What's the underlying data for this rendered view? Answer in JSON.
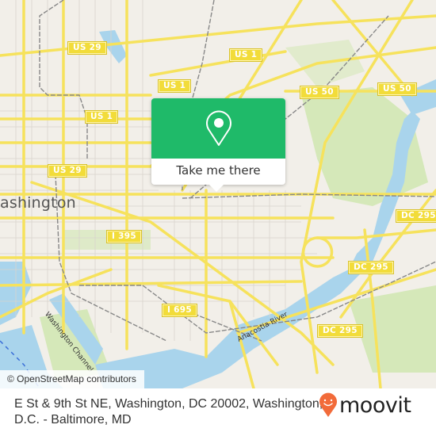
{
  "map": {
    "city_label": "ashington",
    "river_labels": {
      "anacostia": "Anacostia River",
      "washington_channel": "Washington Channel"
    },
    "route_shields": [
      {
        "id": "us29-top",
        "label": "US 29"
      },
      {
        "id": "us1-a",
        "label": "US 1"
      },
      {
        "id": "us1-b",
        "label": "US 1"
      },
      {
        "id": "us1-c",
        "label": "US 1"
      },
      {
        "id": "us50-a",
        "label": "US 50"
      },
      {
        "id": "us50-b",
        "label": "US 50"
      },
      {
        "id": "us29-mid",
        "label": "US 29"
      },
      {
        "id": "i395",
        "label": "I 395"
      },
      {
        "id": "i695",
        "label": "I 695"
      },
      {
        "id": "dc295-a",
        "label": "DC 295"
      },
      {
        "id": "dc295-b",
        "label": "DC 295"
      },
      {
        "id": "dc295-c",
        "label": "DC 295"
      }
    ],
    "attribution": "© OpenStreetMap contributors",
    "colors": {
      "land": "#f2efe9",
      "road": "#f6e25c",
      "water": "#a9d4ec",
      "park": "#d2e6b5",
      "popup_accent": "#1fba69",
      "brand": "#f26b3a"
    }
  },
  "popup": {
    "icon": "location-pin-icon",
    "button_label": "Take me there"
  },
  "footer": {
    "address_line1": "E St & 9th St NE, Washington, DC 20002, Washington,",
    "address_line2": "D.C. - Baltimore, MD",
    "brand": "moovit"
  }
}
